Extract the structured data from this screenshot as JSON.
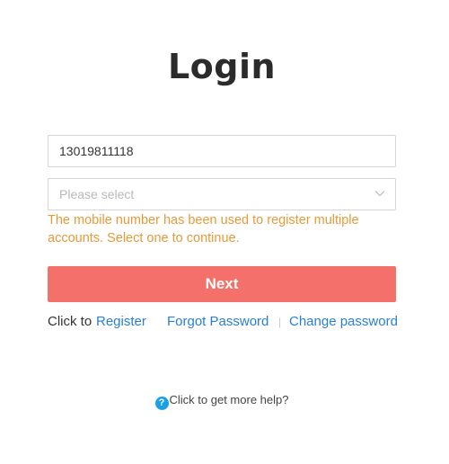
{
  "title": "Login",
  "phone": {
    "value": "13019811118"
  },
  "account_select": {
    "placeholder": "Please select"
  },
  "warning": "The mobile number has been used to register multiple accounts. Select one to continue.",
  "next_button": "Next",
  "links": {
    "click_to": "Click to",
    "register": "Register",
    "forgot_password": "Forgot Password",
    "separator": "|",
    "change_password": "Change password"
  },
  "help": {
    "icon": "?",
    "text": "Click to get more help?"
  },
  "colors": {
    "primary_button": "#f4706b",
    "link": "#2a7fd4",
    "warning": "#e79a36",
    "help_icon": "#1aa0e6"
  }
}
